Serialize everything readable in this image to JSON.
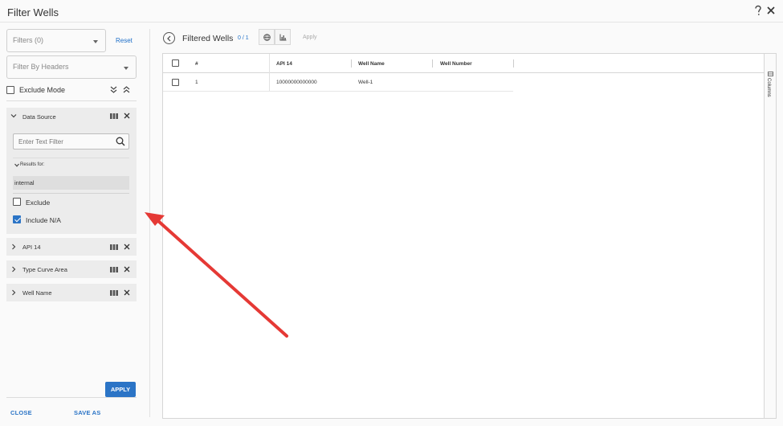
{
  "dialog": {
    "title": "Filter Wells"
  },
  "left": {
    "filters_select": "Filters (0)",
    "reset": "Reset",
    "headers_select": "Filter By Headers",
    "exclude_mode": "Exclude Mode",
    "data_source": {
      "label": "Data Source",
      "text_filter_placeholder": "Enter Text Filter",
      "results_for": "Results for:",
      "result_value": "internal",
      "exclude": "Exclude",
      "include_na": "Include N/A",
      "include_na_checked": true
    },
    "collapsed_filters": [
      {
        "label": "API 14"
      },
      {
        "label": "Type Curve Area"
      },
      {
        "label": "Well Name"
      }
    ],
    "footer": {
      "close": "CLOSE",
      "save_as": "SAVE AS",
      "apply": "APPLY"
    }
  },
  "right": {
    "title": "Filtered Wells",
    "count": "0 / 1",
    "apply": "Apply",
    "columns_label": "Columns",
    "table": {
      "headers": [
        "#",
        "API 14",
        "Well Name",
        "Well Number"
      ],
      "rows": [
        {
          "index": "1",
          "api14": "10000000000000",
          "well_name": "Well-1",
          "well_number": ""
        }
      ]
    }
  },
  "colors": {
    "accent": "#2b74c6",
    "arrow": "#e53935"
  }
}
